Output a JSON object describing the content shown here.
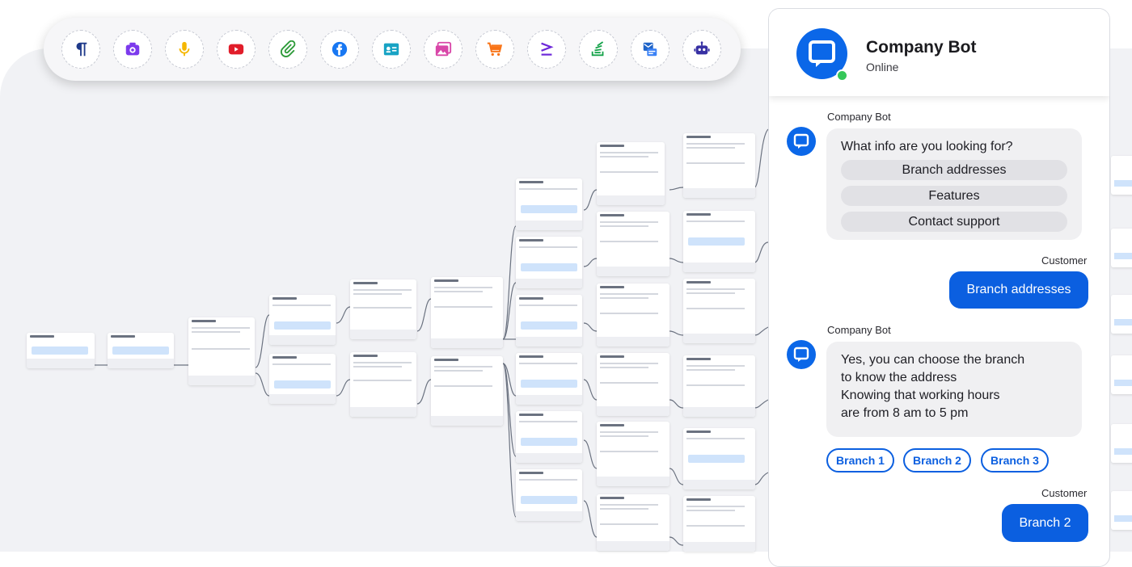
{
  "toolbar": {
    "tools": [
      {
        "name": "paragraph-icon",
        "color": "#1f3a8a"
      },
      {
        "name": "camera-icon",
        "color": "#7c3aed"
      },
      {
        "name": "microphone-icon",
        "color": "#f5b700"
      },
      {
        "name": "youtube-icon",
        "color": "#e11d2a"
      },
      {
        "name": "paperclip-icon",
        "color": "#2e9b3a"
      },
      {
        "name": "facebook-icon",
        "color": "#1877f2"
      },
      {
        "name": "contact-card-icon",
        "color": "#18a3c4"
      },
      {
        "name": "image-gallery-icon",
        "color": "#d946a8"
      },
      {
        "name": "cart-icon",
        "color": "#f97316"
      },
      {
        "name": "greater-equal-icon",
        "color": "#6d28d9"
      },
      {
        "name": "stack-icon",
        "color": "#16a34a"
      },
      {
        "name": "forms-icon",
        "color": "#1e63c7"
      },
      {
        "name": "robot-icon",
        "color": "#3730a3"
      }
    ]
  },
  "chat": {
    "header": {
      "title": "Company Bot",
      "status": "Online"
    },
    "colors": {
      "accent": "#0b5fe0",
      "online": "#35c759"
    },
    "messages": [
      {
        "sender": "Company Bot",
        "text": "What info are you looking for?",
        "options": [
          "Branch addresses",
          "Features",
          "Contact support"
        ]
      },
      {
        "sender": "Customer",
        "text": "Branch addresses"
      },
      {
        "sender": "Company Bot",
        "lines": [
          "Yes, you can choose the branch",
          "to know the address",
          "Knowing that working hours",
          "are from 8 am to 5 pm"
        ],
        "quick_replies": [
          "Branch 1",
          "Branch 2",
          "Branch 3"
        ]
      },
      {
        "sender": "Customer",
        "text": "Branch 2"
      }
    ]
  }
}
